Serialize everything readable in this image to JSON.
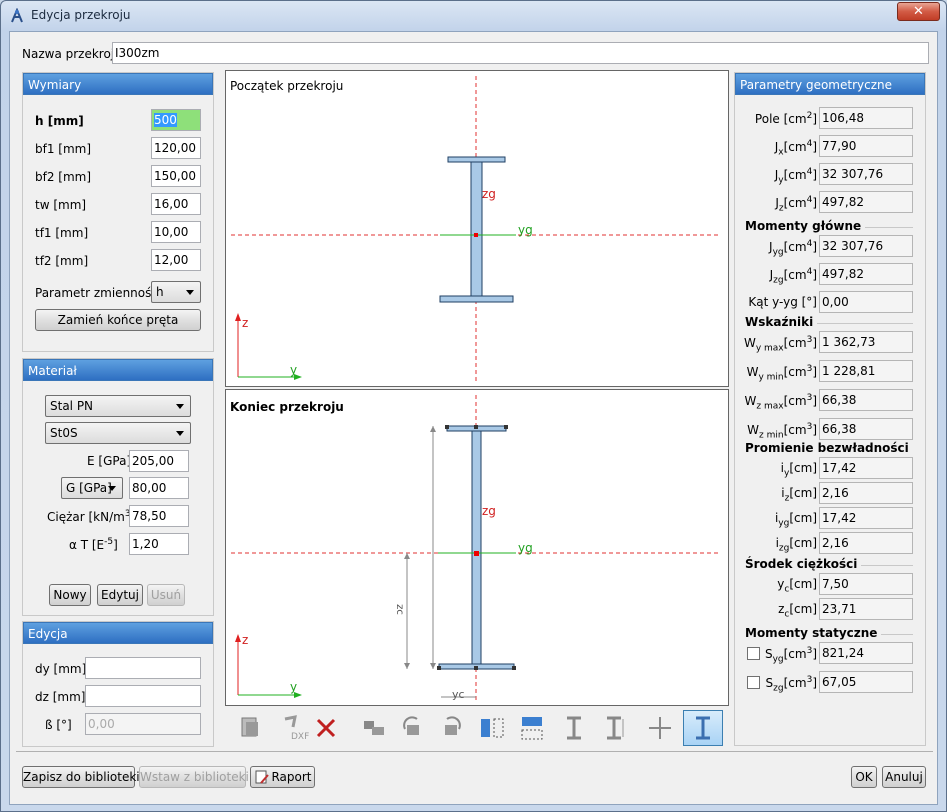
{
  "window": {
    "title": "Edycja przekroju"
  },
  "name_label": "Nazwa przekroju",
  "name_value": "I300zm",
  "dims": {
    "header": "Wymiary",
    "rows": [
      {
        "label": "h [mm]",
        "value": "500"
      },
      {
        "label": "bf1 [mm]",
        "value": "120,00"
      },
      {
        "label": "bf2 [mm]",
        "value": "150,00"
      },
      {
        "label": "tw [mm]",
        "value": "16,00"
      },
      {
        "label": "tf1 [mm]",
        "value": "10,00"
      },
      {
        "label": "tf2 [mm]",
        "value": "12,00"
      }
    ],
    "param_label": "Parametr zmienności",
    "param_value": "h",
    "swap_button": "Zamień końce pręta"
  },
  "material": {
    "header": "Materiał",
    "steel": "Stal PN",
    "grade": "St0S",
    "e_label": "E [GPa]",
    "e_value": "205,00",
    "g_select": "G [GPa]",
    "g_value": "80,00",
    "weight_label": "Ciężar [kN/m",
    "weight_sup": "3",
    "weight_close": "]",
    "weight_value": "78,50",
    "alpha_label": "α T [E",
    "alpha_sup": "-5",
    "alpha_close": "]",
    "alpha_value": "1,20",
    "new_button": "Nowy",
    "edit_button": "Edytuj",
    "delete_button": "Usuń"
  },
  "edit": {
    "header": "Edycja",
    "dy_label": "dy [mm]",
    "dy_value": "",
    "dz_label": "dz [mm]",
    "dz_value": "",
    "beta_label": "ß [°]",
    "beta_placeholder": "0,00"
  },
  "views": {
    "start_title": "Początek przekroju",
    "end_title": "Koniec przekroju",
    "axis_z": "z",
    "axis_y": "y",
    "zg": "zg",
    "yg": "yg",
    "zc": "zc",
    "yc": "yc"
  },
  "toolbar": [
    {
      "name": "copy-icon",
      "active": false
    },
    {
      "name": "dxf-import-icon",
      "active": false,
      "text": "DXF"
    },
    {
      "name": "delete-icon",
      "active": false
    },
    {
      "name": "group-icon",
      "active": false
    },
    {
      "name": "rotate-left-icon",
      "active": false
    },
    {
      "name": "rotate-right-icon",
      "active": false
    },
    {
      "name": "mirror-horizontal-icon",
      "active": false
    },
    {
      "name": "mirror-vertical-icon",
      "active": false
    },
    {
      "name": "width-icon",
      "active": false
    },
    {
      "name": "height-icon",
      "active": false
    },
    {
      "name": "move-icon",
      "active": false
    },
    {
      "name": "dimension-view-icon",
      "active": true
    }
  ],
  "geom": {
    "header": "Parametry geometryczne",
    "basic": [
      {
        "base": "Pole [cm",
        "sub": "",
        "sup": "2",
        "tail": "]",
        "value": "106,48"
      },
      {
        "base": "J",
        "sub": "x",
        "mid": "[cm",
        "sup": "4",
        "tail": "]",
        "value": "77,90"
      },
      {
        "base": "J",
        "sub": "y",
        "mid": "[cm",
        "sup": "4",
        "tail": "]",
        "value": "32 307,76"
      },
      {
        "base": "J",
        "sub": "z",
        "mid": "[cm",
        "sup": "4",
        "tail": "]",
        "value": "497,82"
      }
    ],
    "principal_title": "Momenty główne",
    "principal": [
      {
        "base": "J",
        "sub": "yg",
        "mid": "[cm",
        "sup": "4",
        "tail": "]",
        "value": "32 307,76"
      },
      {
        "base": "J",
        "sub": "zg",
        "mid": "[cm",
        "sup": "4",
        "tail": "]",
        "value": "497,82"
      },
      {
        "base": "Kąt y-yg [°]",
        "sub": "",
        "mid": "",
        "sup": "",
        "tail": "",
        "value": "0,00"
      }
    ],
    "moduli_title": "Wskaźniki",
    "moduli": [
      {
        "base": "W",
        "sub": "y max",
        "mid": "[cm",
        "sup": "3",
        "tail": "]",
        "value": "1 362,73"
      },
      {
        "base": "W",
        "sub": "y min",
        "mid": "[cm",
        "sup": "3",
        "tail": "]",
        "value": "1 228,81"
      },
      {
        "base": "W",
        "sub": "z max",
        "mid": "[cm",
        "sup": "3",
        "tail": "]",
        "value": "66,38"
      },
      {
        "base": "W",
        "sub": "z min",
        "mid": "[cm",
        "sup": "3",
        "tail": "]",
        "value": "66,38"
      }
    ],
    "radii_title": "Promienie bezwładności",
    "radii": [
      {
        "base": "i",
        "sub": "y",
        "mid": "[cm]",
        "value": "17,42"
      },
      {
        "base": "i",
        "sub": "z",
        "mid": "[cm]",
        "value": "2,16"
      },
      {
        "base": "i",
        "sub": "yg",
        "mid": "[cm]",
        "value": "17,42"
      },
      {
        "base": "i",
        "sub": "zg",
        "mid": "[cm]",
        "value": "2,16"
      }
    ],
    "centroid_title": "Środek ciężkości",
    "centroid": [
      {
        "base": "y",
        "sub": "c",
        "mid": "[cm]",
        "value": "7,50"
      },
      {
        "base": "z",
        "sub": "c",
        "mid": "[cm]",
        "value": "23,71"
      }
    ],
    "static_title": "Momenty statyczne",
    "static": [
      {
        "base": "S",
        "sub": "yg",
        "mid": "[cm",
        "sup": "3",
        "tail": "]",
        "value": "821,24"
      },
      {
        "base": "S",
        "sub": "zg",
        "mid": "[cm",
        "sup": "3",
        "tail": "]",
        "value": "67,05"
      }
    ]
  },
  "bottom": {
    "save_library": "Zapisz do biblioteki",
    "insert_library": "Wstaw z biblioteki",
    "report": "Raport",
    "ok": "OK",
    "cancel": "Anuluj"
  }
}
